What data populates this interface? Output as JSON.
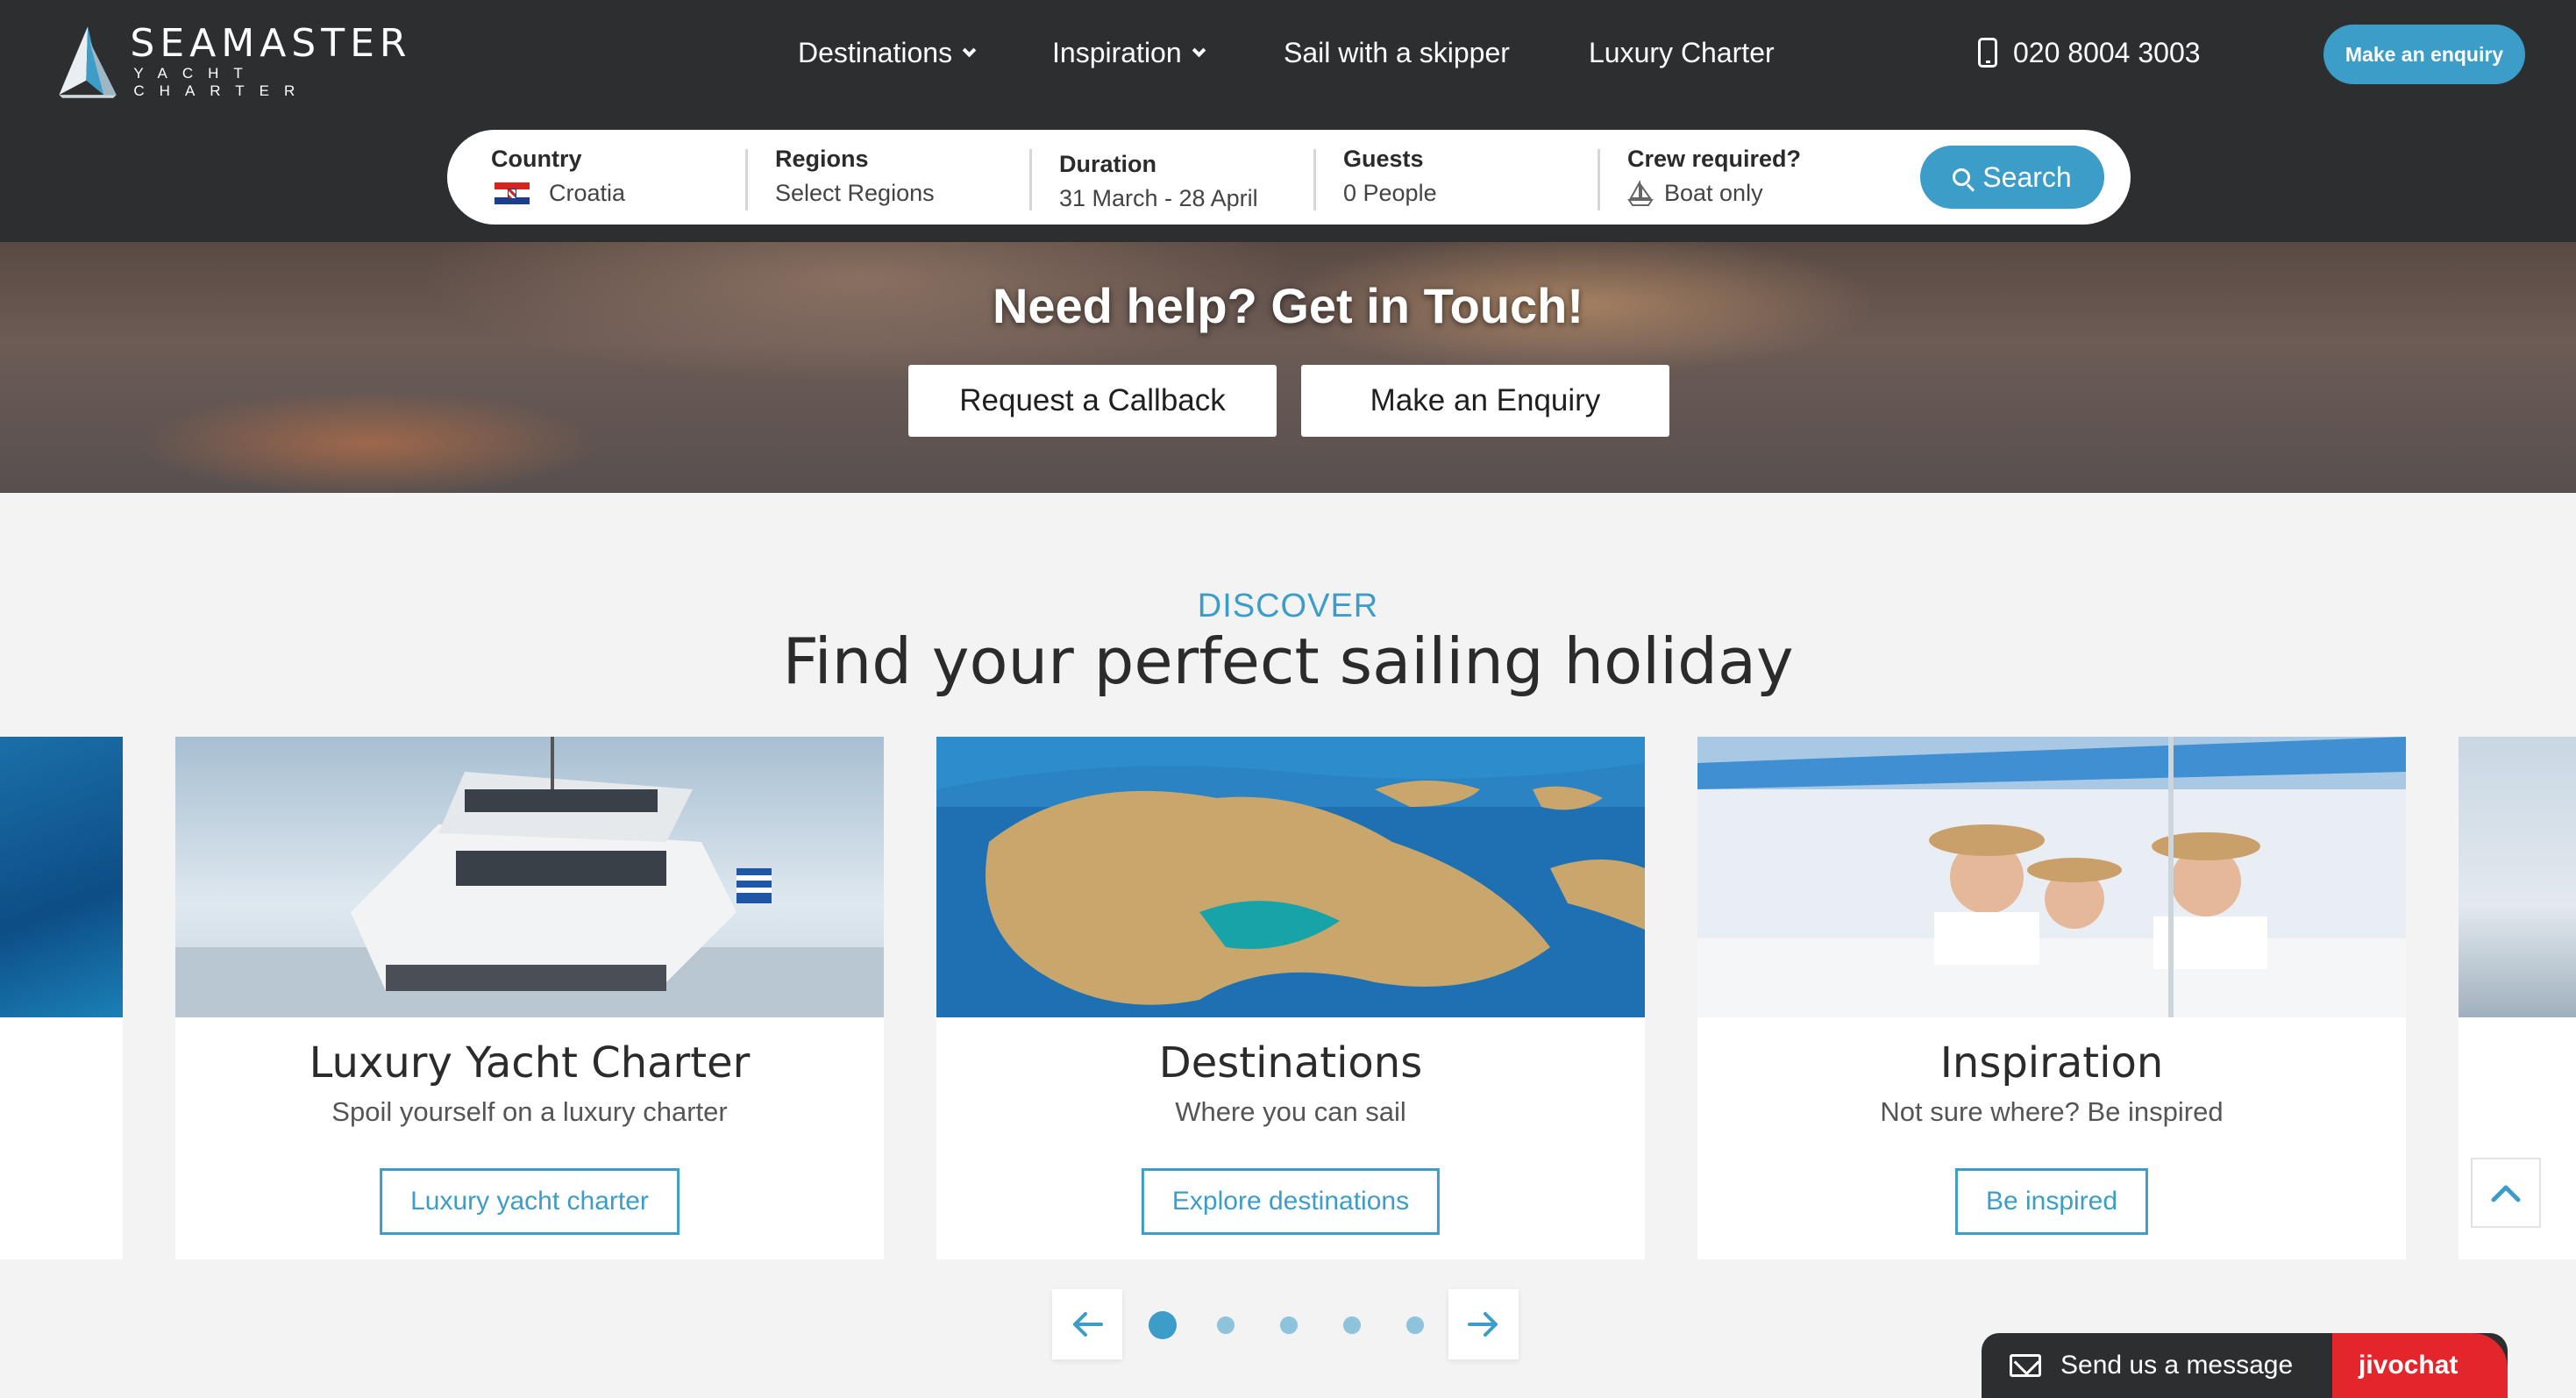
{
  "header": {
    "logo_title": "SEAMASTER",
    "logo_subtitle": "YACHT CHARTER",
    "nav": [
      "Destinations",
      "Inspiration",
      "Sail with a skipper",
      "Luxury Charter"
    ],
    "phone": "020 8004 3003",
    "enquiry_label": "Make an enquiry"
  },
  "search": {
    "country_label": "Country",
    "country_value": "Croatia",
    "regions_label": "Regions",
    "regions_value": "Select Regions",
    "duration_label": "Duration",
    "duration_value": "31 March - 28 April",
    "guests_label": "Guests",
    "guests_value": "0 People",
    "crew_label": "Crew required?",
    "crew_value": "Boat only",
    "search_label": "Search"
  },
  "hero": {
    "title": "Need help? Get in Touch!",
    "callback_label": "Request a Callback",
    "enquiry_label": "Make an Enquiry"
  },
  "discover": {
    "kicker": "DISCOVER",
    "heading": "Find your perfect sailing holiday"
  },
  "cards": [
    {
      "title": "Luxury Yacht Charter",
      "subtitle": "Spoil yourself on a luxury charter",
      "cta": "Luxury yacht charter"
    },
    {
      "title": "Destinations",
      "subtitle": "Where you can sail",
      "cta": "Explore destinations"
    },
    {
      "title": "Inspiration",
      "subtitle": "Not sure where? Be inspired",
      "cta": "Be inspired"
    }
  ],
  "carousel": {
    "active_dot": 1,
    "dot_count": 5
  },
  "chat": {
    "message": "Send us a message",
    "brand": "jivochat"
  },
  "colors": {
    "accent": "#3b9dc8",
    "header": "#2c2e30",
    "chat_brand": "#e3262b"
  },
  "icons": [
    "chevron-down-icon",
    "phone-icon",
    "croatia-flag-icon",
    "boat-icon",
    "search-icon",
    "arrow-left-icon",
    "arrow-right-icon",
    "chevron-up-icon",
    "mail-icon"
  ]
}
